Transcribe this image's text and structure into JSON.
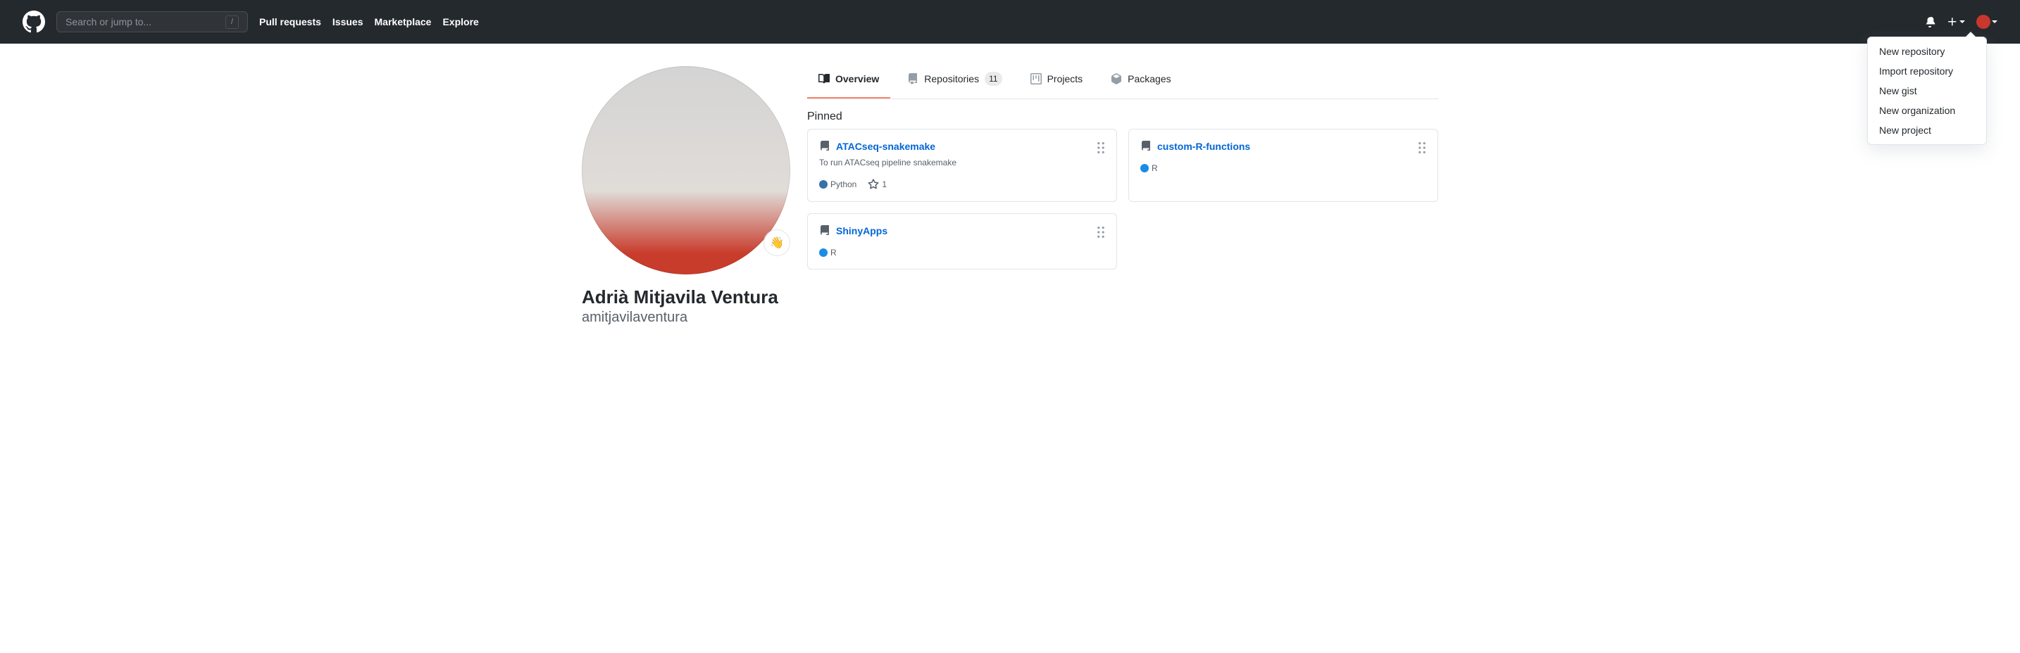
{
  "search": {
    "placeholder": "Search or jump to...",
    "slash": "/"
  },
  "nav": {
    "pulls": "Pull requests",
    "issues": "Issues",
    "marketplace": "Marketplace",
    "explore": "Explore"
  },
  "dropdown": {
    "new_repo": "New repository",
    "import_repo": "Import repository",
    "new_gist": "New gist",
    "new_org": "New organization",
    "new_project": "New project"
  },
  "profile": {
    "name": "Adrià Mitjavila Ventura",
    "username": "amitjavilaventura",
    "status_emoji": "👋"
  },
  "tabs": {
    "overview": "Overview",
    "repositories": "Repositories",
    "repo_count": "11",
    "projects": "Projects",
    "packages": "Packages"
  },
  "pinned": {
    "title": "Pinned",
    "repos": [
      {
        "name": "ATACseq-snakemake",
        "desc": "To run ATACseq pipeline snakemake",
        "lang": "Python",
        "lang_color": "#3572A5",
        "stars": "1"
      },
      {
        "name": "custom-R-functions",
        "desc": "",
        "lang": "R",
        "lang_color": "#198CE7",
        "stars": ""
      },
      {
        "name": "ShinyApps",
        "desc": "",
        "lang": "R",
        "lang_color": "#198CE7",
        "stars": ""
      }
    ]
  }
}
